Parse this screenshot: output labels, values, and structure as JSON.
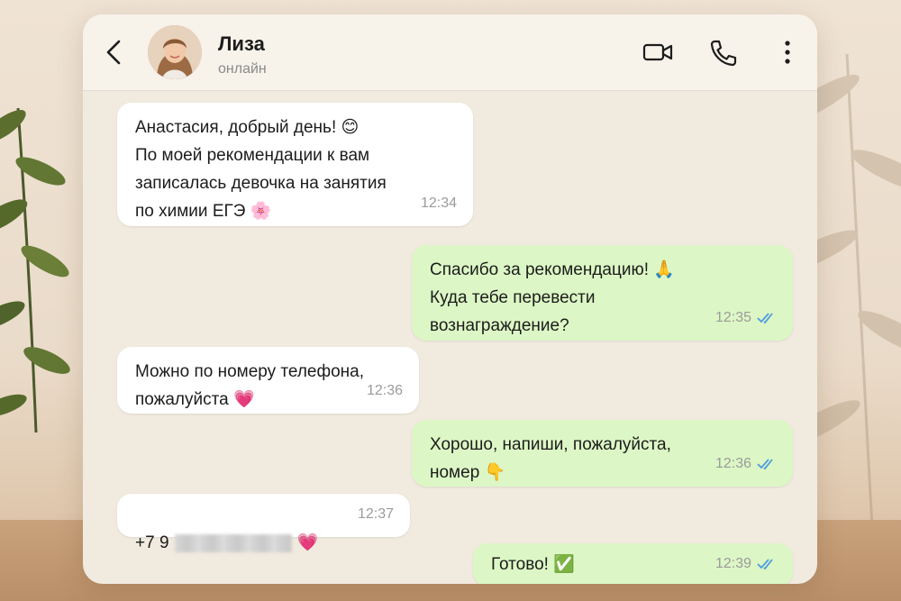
{
  "header": {
    "contact_name": "Лиза",
    "contact_status": "онлайн"
  },
  "messages": [
    {
      "direction": "in",
      "text": "Анастасия, добрый день! 😊\nПо моей рекомендации к вам\nзаписалась девочка на занятия\nпо химии ЕГЭ 🌸",
      "time": "12:34"
    },
    {
      "direction": "out",
      "text": "Спасибо за рекомендацию! 🙏\nКуда тебе перевести\nвознаграждение?",
      "time": "12:35",
      "read": true
    },
    {
      "direction": "in",
      "text": "Можно по номеру телефона,\nпожалуйста 💗",
      "time": "12:36"
    },
    {
      "direction": "out",
      "text": "Хорошо, напиши, пожалуйста,\nномер 👇",
      "time": "12:36",
      "read": true
    },
    {
      "direction": "in",
      "text_prefix": "+7 9",
      "text_suffix": "💗",
      "phone_hidden": true,
      "time": "12:37"
    },
    {
      "direction": "out",
      "text": "Готово! ✅",
      "time": "12:39",
      "read": true
    }
  ],
  "colors": {
    "incoming_bubble": "#ffffff",
    "outgoing_bubble": "#dcf7c5",
    "read_ticks": "#4f9be0",
    "chat_background": "#f1eadf"
  },
  "icons": [
    "back-arrow-icon",
    "video-call-icon",
    "phone-icon",
    "more-menu-icon",
    "double-check-icon"
  ]
}
